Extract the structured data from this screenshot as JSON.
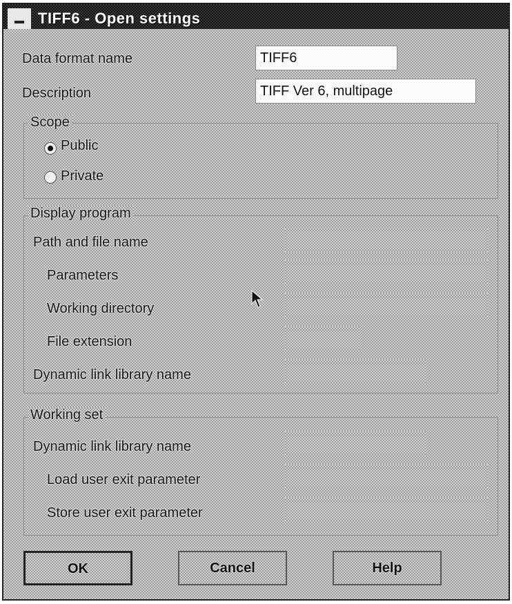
{
  "window": {
    "title": "TIFF6 - Open settings"
  },
  "fields": {
    "data_format_name": {
      "label": "Data format name",
      "value": "TIFF6"
    },
    "description": {
      "label": "Description",
      "value": "TIFF Ver 6, multipage"
    }
  },
  "scope": {
    "title": "Scope",
    "options": [
      {
        "label": "Public",
        "selected": true
      },
      {
        "label": "Private",
        "selected": false
      }
    ]
  },
  "display_program": {
    "title": "Display program",
    "path_label": "Path and file name",
    "parameters_label": "Parameters",
    "working_directory_label": "Working directory",
    "file_extension_label": "File extension",
    "dll_label": "Dynamic link library name"
  },
  "working_set": {
    "title": "Working set",
    "dll_label": "Dynamic link library name",
    "load_exit_label": "Load user exit parameter",
    "store_exit_label": "Store user exit parameter"
  },
  "buttons": {
    "ok": "OK",
    "cancel": "Cancel",
    "help": "Help"
  }
}
